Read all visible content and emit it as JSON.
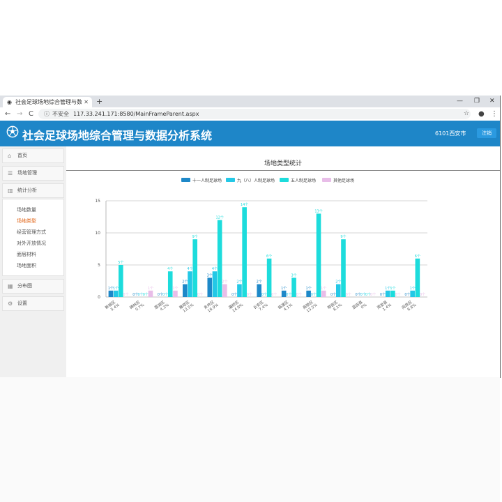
{
  "browser": {
    "tab_title": "社会足球场地综合管理与数据分析系统",
    "new_tab": "+",
    "security": "不安全",
    "url": "117.33.241.171:8580/MainFrameParent.aspx",
    "nav_back": "←",
    "nav_forward": "→",
    "nav_reload": "C"
  },
  "app": {
    "title": "社会足球场地综合管理与数据分析系统",
    "user": "6101西安市",
    "logout": "注销"
  },
  "sidebar": {
    "menus": [
      {
        "label": "首页",
        "icon": "home-icon"
      },
      {
        "label": "场地管理",
        "icon": "list-icon"
      },
      {
        "label": "统计分析",
        "icon": "bar-chart-icon"
      }
    ],
    "submenu": [
      {
        "label": "场地数量",
        "active": false
      },
      {
        "label": "场地类型",
        "active": true
      },
      {
        "label": "经营管理方式",
        "active": false
      },
      {
        "label": "对外开放情况",
        "active": false
      },
      {
        "label": "面层材料",
        "active": false
      },
      {
        "label": "场地面积",
        "active": false
      }
    ],
    "menus_bottom": [
      {
        "label": "分布图",
        "icon": "map-icon"
      },
      {
        "label": "设置",
        "icon": "gear-icon"
      }
    ]
  },
  "chart_data": {
    "type": "bar",
    "title": "场地类型统计",
    "legend_position": "top-center",
    "ylim": [
      0,
      15
    ],
    "yticks": [
      0,
      5,
      10,
      15
    ],
    "grid": true,
    "categories": [
      {
        "name": "新城区",
        "pct": "5.4%"
      },
      {
        "name": "碑林区",
        "pct": "0.7%"
      },
      {
        "name": "莲湖区",
        "pct": "4.3%"
      },
      {
        "name": "雁塔区",
        "pct": "13.5%"
      },
      {
        "name": "未央区",
        "pct": "16.9%"
      },
      {
        "name": "灞桥区",
        "pct": "14.9%"
      },
      {
        "name": "长安区",
        "pct": "7.4%"
      },
      {
        "name": "临潼区",
        "pct": "4.1%"
      },
      {
        "name": "高陵区",
        "pct": "13.5%"
      },
      {
        "name": "鄠邑区",
        "pct": "8.1%"
      },
      {
        "name": "蓝田县",
        "pct": "0%"
      },
      {
        "name": "周至县",
        "pct": "1.4%"
      },
      {
        "name": "阎良区",
        "pct": "6.8%"
      }
    ],
    "series": [
      {
        "name": "十一人制足球场",
        "color": "#1e88c8",
        "values": [
          1,
          0,
          0,
          2,
          3,
          0,
          2,
          1,
          1,
          0,
          0,
          0,
          0
        ]
      },
      {
        "name": "九（八）人制足球场",
        "color": "#24c8e6",
        "values": [
          1,
          0,
          0,
          4,
          4,
          2,
          0,
          0,
          0,
          2,
          0,
          1,
          1
        ]
      },
      {
        "name": "五人制足球场",
        "color": "#1ddcdc",
        "values": [
          5,
          0,
          4,
          9,
          12,
          14,
          6,
          3,
          13,
          9,
          0,
          1,
          6
        ]
      },
      {
        "name": "其他足球场",
        "color": "#e8bde8",
        "values": [
          0,
          1,
          1,
          0,
          2,
          0,
          0,
          0,
          1,
          0,
          0,
          0,
          0
        ]
      }
    ],
    "value_suffix": "个"
  }
}
